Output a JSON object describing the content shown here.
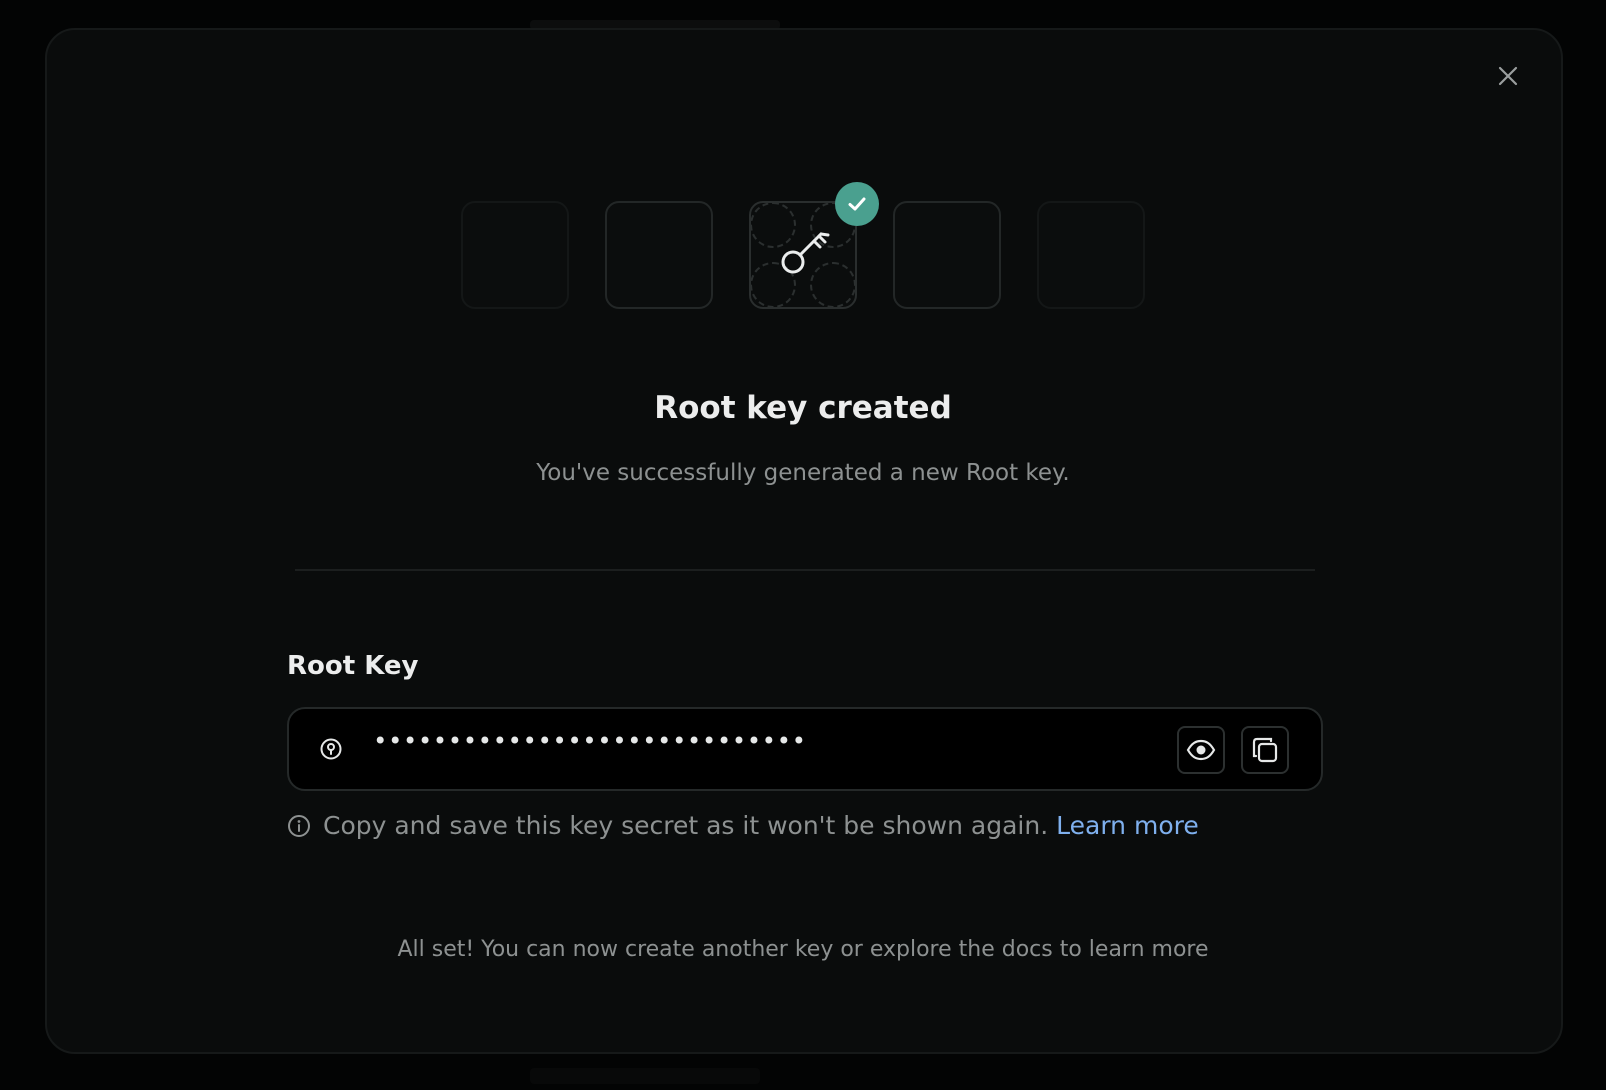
{
  "dialog": {
    "title": "Root key created",
    "subtitle": "You've successfully generated a new Root key.",
    "field": {
      "label": "Root Key",
      "masked_value": "•••••••••••••••••••••••••••••"
    },
    "note": {
      "text": "Copy and save this key secret as it won't be shown again.",
      "link_label": "Learn more"
    },
    "footer": "All set! You can now create another key or explore the docs to learn more"
  },
  "icons": {
    "close": "close-icon",
    "key": "key-icon",
    "check": "check-icon",
    "pin": "key-pin-icon",
    "eye": "eye-icon",
    "copy": "copy-icon",
    "info": "info-icon"
  },
  "colors": {
    "success": "#4aa08f",
    "link": "#7fb0ee",
    "background": "#0a0c0c"
  }
}
